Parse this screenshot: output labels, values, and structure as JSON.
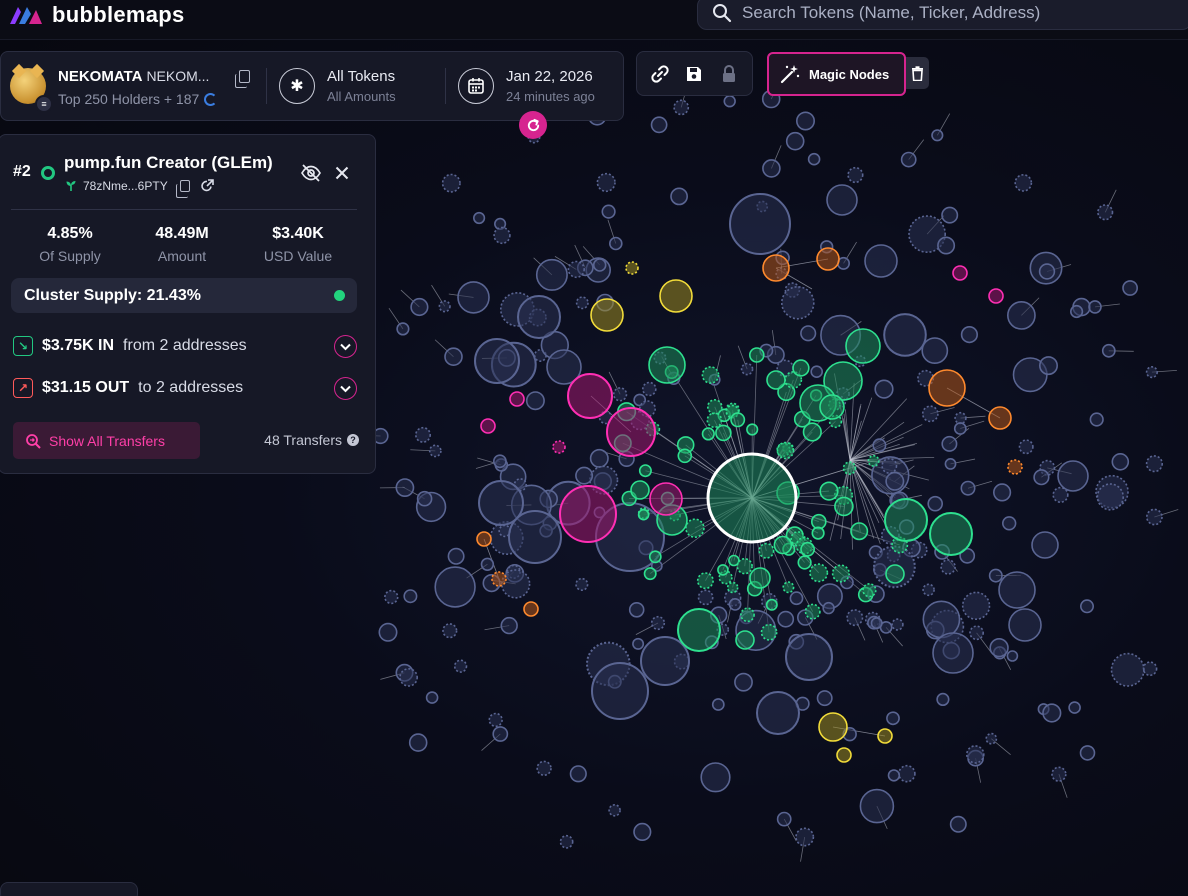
{
  "app": {
    "name": "bubblemaps",
    "brand_colors": {
      "logo_left": "#8c3cff",
      "logo_mid": "#3a7de0",
      "logo_right": "#d6248f",
      "accent": "#d6248f",
      "green": "#22c781"
    }
  },
  "search": {
    "placeholder": "Search Tokens (Name, Ticker, Address)",
    "icon": "search-icon"
  },
  "token": {
    "name": "NEKOMATA",
    "ticker": "NEKOM...",
    "holders_text": "Top 250 Holders + 187",
    "filter_title": "All Tokens",
    "filter_sub": "All Amounts",
    "date_title": "Jan 22, 2026",
    "date_sub": "24 minutes ago"
  },
  "toolbar": {
    "icons": [
      "link-icon",
      "save-icon",
      "lock-icon"
    ],
    "magic_nodes_label": "Magic Nodes",
    "trash_icon": "trash-icon"
  },
  "holder_panel": {
    "rank": "#2",
    "name": "pump.fun Creator (GLEm)",
    "address": "78zNme...6PTY",
    "stats": [
      {
        "value": "4.85%",
        "label": "Of Supply"
      },
      {
        "value": "48.49M",
        "label": "Amount"
      },
      {
        "value": "$3.40K",
        "label": "USD Value"
      }
    ],
    "cluster_supply": "Cluster Supply: 21.43%",
    "inflow": {
      "amount": "$3.75K IN",
      "text": "from 2 addresses"
    },
    "outflow": {
      "amount": "$31.15 OUT",
      "text": "to 2 addresses"
    },
    "show_transfers_label": "Show All Transfers",
    "transfers_count": "48 Transfers"
  },
  "bubbles": {
    "colors": {
      "default": "#2a3152",
      "green": "#1e8a5a",
      "magenta": "#a0186e",
      "yellow": "#9a8a20",
      "orange": "#b0561a"
    }
  }
}
